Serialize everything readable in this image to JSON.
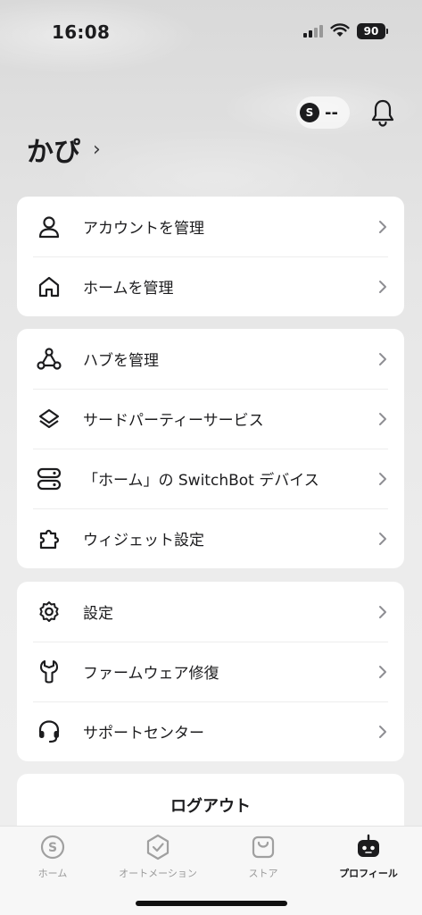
{
  "status_bar": {
    "time": "16:08",
    "battery": "90"
  },
  "header": {
    "points_icon_text": "S",
    "points_value": "--",
    "user_name": "かぴ"
  },
  "sections": [
    {
      "items": [
        {
          "icon": "person-icon",
          "label": "アカウントを管理"
        },
        {
          "icon": "house-icon",
          "label": "ホームを管理"
        }
      ]
    },
    {
      "items": [
        {
          "icon": "hub-icon",
          "label": "ハブを管理"
        },
        {
          "icon": "layers-icon",
          "label": "サードパーティーサービス"
        },
        {
          "icon": "server-icon",
          "label": "「ホーム」の SwitchBot デバイス"
        },
        {
          "icon": "puzzle-icon",
          "label": "ウィジェット設定"
        }
      ]
    },
    {
      "items": [
        {
          "icon": "gear-icon",
          "label": "設定"
        },
        {
          "icon": "wrench-icon",
          "label": "ファームウェア修復"
        },
        {
          "icon": "headset-icon",
          "label": "サポートセンター"
        }
      ]
    }
  ],
  "logout_label": "ログアウト",
  "tabs": [
    {
      "icon": "home-coin-icon",
      "label": "ホーム",
      "active": false
    },
    {
      "icon": "automation-icon",
      "label": "オートメーション",
      "active": false
    },
    {
      "icon": "store-icon",
      "label": "ストア",
      "active": false
    },
    {
      "icon": "robot-icon",
      "label": "プロフィール",
      "active": true
    }
  ]
}
